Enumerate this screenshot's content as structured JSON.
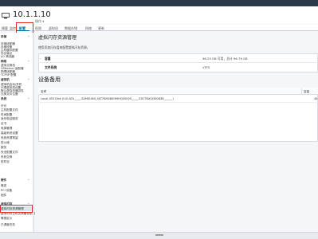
{
  "header": {
    "host": "10.1.1.10",
    "actions": "操作 ▾"
  },
  "tabs": [
    {
      "label": "摘要"
    },
    {
      "label": "监控"
    },
    {
      "label": "配置"
    },
    {
      "label": "权限"
    },
    {
      "label": "虚拟机"
    },
    {
      "label": "数据存储"
    },
    {
      "label": "网络"
    },
    {
      "label": "更新"
    }
  ],
  "sidebar": {
    "items": [
      {
        "label": "存储",
        "group": true
      },
      {
        "label": "存储适配器"
      },
      {
        "label": "存储设备"
      },
      {
        "label": "主机缓存配置"
      },
      {
        "label": "协议端点"
      },
      {
        "label": "I/O 筛选器"
      },
      {
        "label": "网络",
        "group": true
      },
      {
        "label": "虚拟交换机"
      },
      {
        "label": "VMkernel 适配器"
      },
      {
        "label": "物理适配器"
      },
      {
        "label": "TCP/IP 配置"
      },
      {
        "label": "虚拟机",
        "group": true
      },
      {
        "label": "虚拟机启动/关机"
      },
      {
        "label": "代理虚拟机设置"
      },
      {
        "label": "默认虚拟机兼容性"
      },
      {
        "label": "交换文件位置"
      },
      {
        "label": "系统",
        "group": true
      },
      {
        "label": "许可"
      },
      {
        "label": "主机配置文件"
      },
      {
        "label": "时间配置"
      },
      {
        "label": "身份验证服务"
      },
      {
        "label": "证书"
      },
      {
        "label": "电源管理"
      },
      {
        "label": "高级系统设置"
      },
      {
        "label": "系统资源预留"
      },
      {
        "label": "防火墙"
      },
      {
        "label": "服务"
      },
      {
        "label": "安全配置文件"
      },
      {
        "label": "系统交换"
      },
      {
        "label": "软件包"
      },
      {
        "label": "硬件",
        "group": true
      },
      {
        "label": "概述"
      },
      {
        "label": "PCI 设备"
      },
      {
        "label": "固件"
      },
      {
        "label": "虚拟闪存",
        "group": true
      },
      {
        "label": "虚拟闪存资源管理"
      },
      {
        "label": "虚拟闪存主机交换缓存配置"
      },
      {
        "label": "警报定义"
      },
      {
        "label": "已调度任务"
      }
    ]
  },
  "main": {
    "title": "虚拟闪存资源管理",
    "description": "使用添加闪存盘来配置虚拟闪存资源。",
    "properties": [
      {
        "label": "容量",
        "value": "96.25 GB 可用，总计 96.79 GB"
      },
      {
        "label": "文件系统",
        "value": "VFFS"
      }
    ],
    "devices_title": "设备备用",
    "devices": {
      "columns": [
        "名称",
        "容量"
      ],
      "rows": [
        {
          "name": "Local ATA Disk (t10.ATA_____SAMSUNG_MZ7KM480HMHQ00005_____S3CTNX0J300838______)",
          "capacity": "44"
        }
      ]
    }
  },
  "colors": {
    "accent": "#0072a3",
    "highlight": "#e0282d",
    "topbar": "#2b3a48"
  }
}
